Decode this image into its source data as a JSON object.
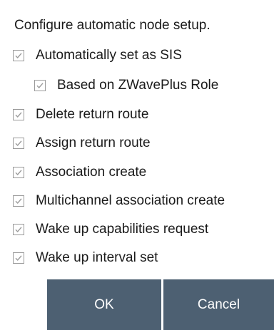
{
  "dialog": {
    "title": "Configure automatic node setup.",
    "options": [
      {
        "label": "Automatically set as SIS",
        "checked": true,
        "indent": false
      },
      {
        "label": "Based on ZWavePlus Role",
        "checked": true,
        "indent": true
      },
      {
        "label": "Delete return route",
        "checked": true,
        "indent": false
      },
      {
        "label": "Assign return route",
        "checked": true,
        "indent": false
      },
      {
        "label": "Association create",
        "checked": true,
        "indent": false
      },
      {
        "label": "Multichannel association create",
        "checked": true,
        "indent": false
      },
      {
        "label": "Wake up capabilities request",
        "checked": true,
        "indent": false
      },
      {
        "label": "Wake up interval set",
        "checked": true,
        "indent": false
      }
    ],
    "buttons": {
      "ok_label": "OK",
      "cancel_label": "Cancel"
    },
    "colors": {
      "button_bg": "#4d6072",
      "button_text": "#ffffff",
      "checkbox_border": "#9a9a9a",
      "checkmark": "#9a9a9a"
    },
    "icons": {
      "checkmark": "checkmark-icon"
    }
  }
}
